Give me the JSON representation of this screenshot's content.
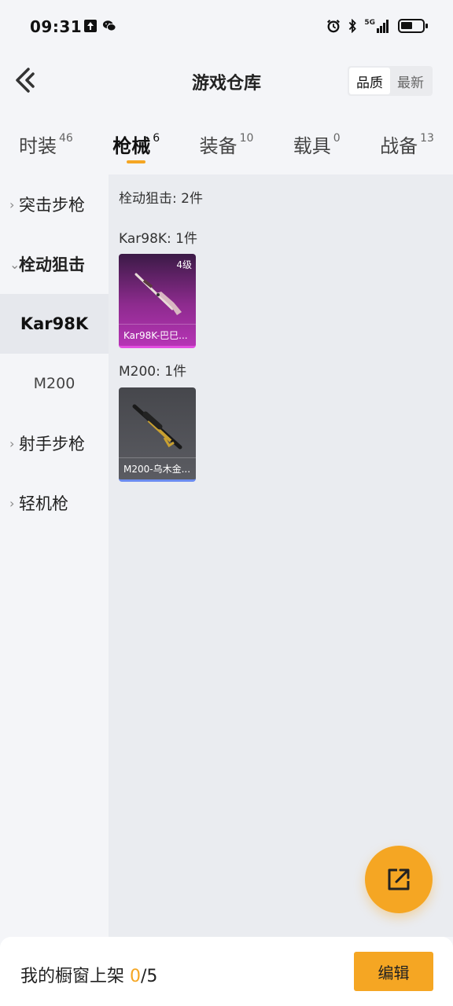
{
  "status_bar": {
    "time": "09:31",
    "left_icons": [
      "upload-icon",
      "wechat-icon"
    ],
    "right_icons": [
      "alarm-icon",
      "bluetooth-icon",
      "signal-5g-icon",
      "battery-icon"
    ],
    "network_label": "5G",
    "battery_level": 0.55
  },
  "header": {
    "title": "游戏仓库",
    "sort_options": [
      "品质",
      "最新"
    ],
    "sort_active": "品质"
  },
  "category_tabs": [
    {
      "label": "时装",
      "count": "46",
      "active": false
    },
    {
      "label": "枪械",
      "count": "6",
      "active": true
    },
    {
      "label": "装备",
      "count": "10",
      "active": false
    },
    {
      "label": "载具",
      "count": "0",
      "active": false
    },
    {
      "label": "战备",
      "count": "13",
      "active": false
    }
  ],
  "sidebar": {
    "groups": [
      {
        "label": "突击步枪",
        "expanded": false
      },
      {
        "label": "栓动狙击",
        "expanded": true
      },
      {
        "label": "射手步枪",
        "expanded": false
      },
      {
        "label": "轻机枪",
        "expanded": false
      }
    ],
    "sub_items": [
      {
        "label": "Kar98K",
        "active": true
      },
      {
        "label": "M200",
        "active": false
      }
    ]
  },
  "content": {
    "section_title": "栓动狙击: 2件",
    "groups": [
      {
        "title": "Kar98K: 1件",
        "item_name": "Kar98K-巴巳...",
        "level": "4级",
        "rarity_color": "#b634b5"
      },
      {
        "title": "M200: 1件",
        "item_name": "M200-乌木金...",
        "level": "",
        "rarity_color": "#6c8cf0"
      }
    ]
  },
  "bottom_bar": {
    "shelf_label": "我的橱窗上架 ",
    "shelf_count": "0",
    "shelf_total": "/5",
    "edit_label": "编辑"
  },
  "fab": {
    "icon": "external-link-icon"
  },
  "colors": {
    "accent": "#f5a623",
    "purple": "#b634b5",
    "blue": "#6c8cf0"
  }
}
